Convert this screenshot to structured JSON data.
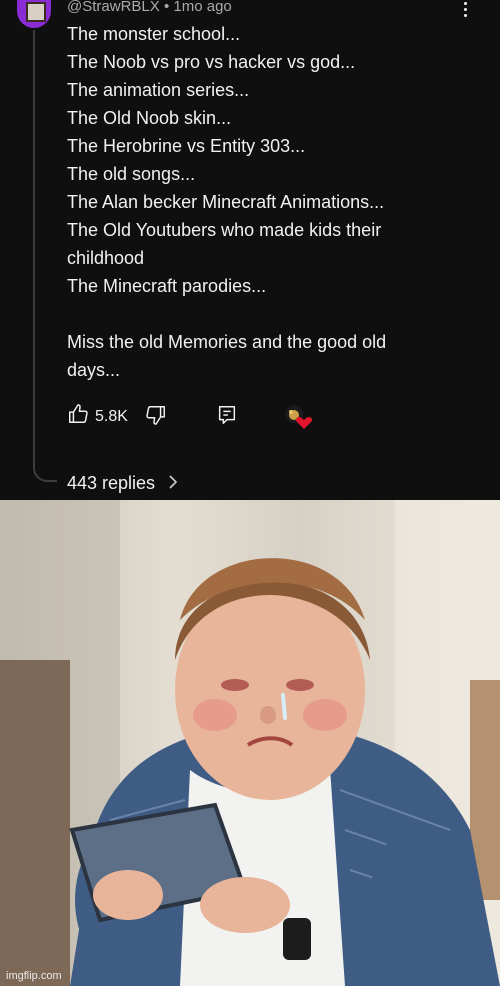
{
  "comment": {
    "handle": "@StrawRBLX",
    "separator": "•",
    "time_ago": "1mo ago",
    "lines": [
      "The monster school...",
      "The Noob vs pro vs hacker vs god...",
      "The animation series...",
      "The Old Noob skin...",
      "The Herobrine vs Entity 303...",
      "The old songs...",
      "The Alan becker Minecraft Animations...",
      "The Old Youtubers who made kids their",
      "childhood",
      "The Minecraft parodies..."
    ],
    "closing_lines": [
      "Miss the old Memories and the good old",
      "days..."
    ],
    "like_count": "5.8K",
    "replies_label": "443 replies",
    "icons": [
      "avatar",
      "more-vert-icon",
      "thumbs-up-icon",
      "thumbs-down-icon",
      "reply-icon",
      "creator-heart-icon",
      "chevron-right-icon"
    ],
    "colors": {
      "background": "#0f0f0f",
      "text": "#f1f1f1",
      "secondary": "#aaaaaa",
      "heart": "#e0152b",
      "avatar": "#8a2bd6"
    }
  },
  "photo": {
    "subject": "crying boy looking at tablet",
    "watermark": "imgflip.com"
  }
}
